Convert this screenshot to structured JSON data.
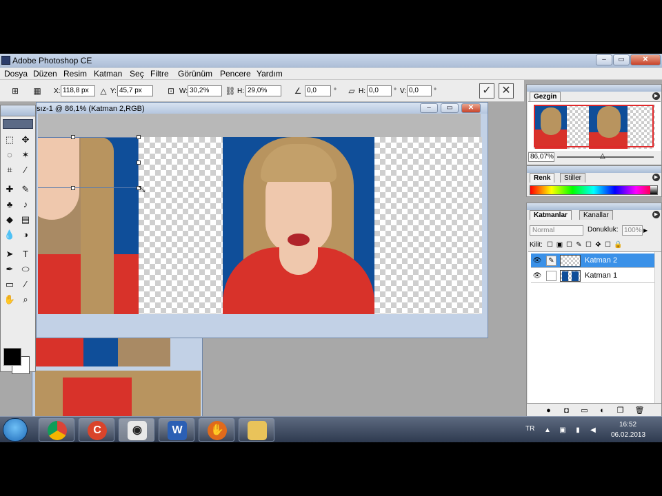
{
  "window": {
    "title": "Adobe Photoshop CE"
  },
  "menu": [
    "Dosya",
    "Düzen",
    "Resim",
    "Katman",
    "Seç",
    "Filtre",
    "Görünüm",
    "Pencere",
    "Yardım"
  ],
  "options": {
    "x_label": "X:",
    "x_value": "118,8 px",
    "y_label": "Y:",
    "y_value": "45,7 px",
    "w_label": "W:",
    "w_value": "30,2%",
    "h_label": "H:",
    "h_value": "29,0%",
    "angle_value": "0,0",
    "hskew_label": "H:",
    "hskew_value": "0,0",
    "vskew_label": "V:",
    "vskew_value": "0,0",
    "degree_mark": "°"
  },
  "document": {
    "title": "sız-1 @ 86,1% (Katman 2,RGB)"
  },
  "navigator": {
    "tab": "Gezgin",
    "zoom": "86,07%"
  },
  "color_panel": {
    "tabs": [
      "Renk",
      "Stiller"
    ]
  },
  "layers_panel": {
    "tabs": [
      "Katmanlar",
      "Kanallar"
    ],
    "blend_mode": "Normal",
    "opacity_label": "Donukluk:",
    "opacity_value": "100%",
    "lock_label": "Kilit:",
    "layers": [
      {
        "name": "Katman 2",
        "selected": true
      },
      {
        "name": "Katman 1",
        "selected": false
      }
    ]
  },
  "taskbar": {
    "language": "TR",
    "time": "16:52",
    "date": "06.02.2013",
    "apps": [
      "chrome",
      "ccleaner",
      "eye-app",
      "word",
      "hand-app",
      "folder"
    ]
  },
  "colors": {
    "selection": "#3a91e8",
    "photo_bg": "#0f4e99",
    "dress": "#d8322a"
  }
}
